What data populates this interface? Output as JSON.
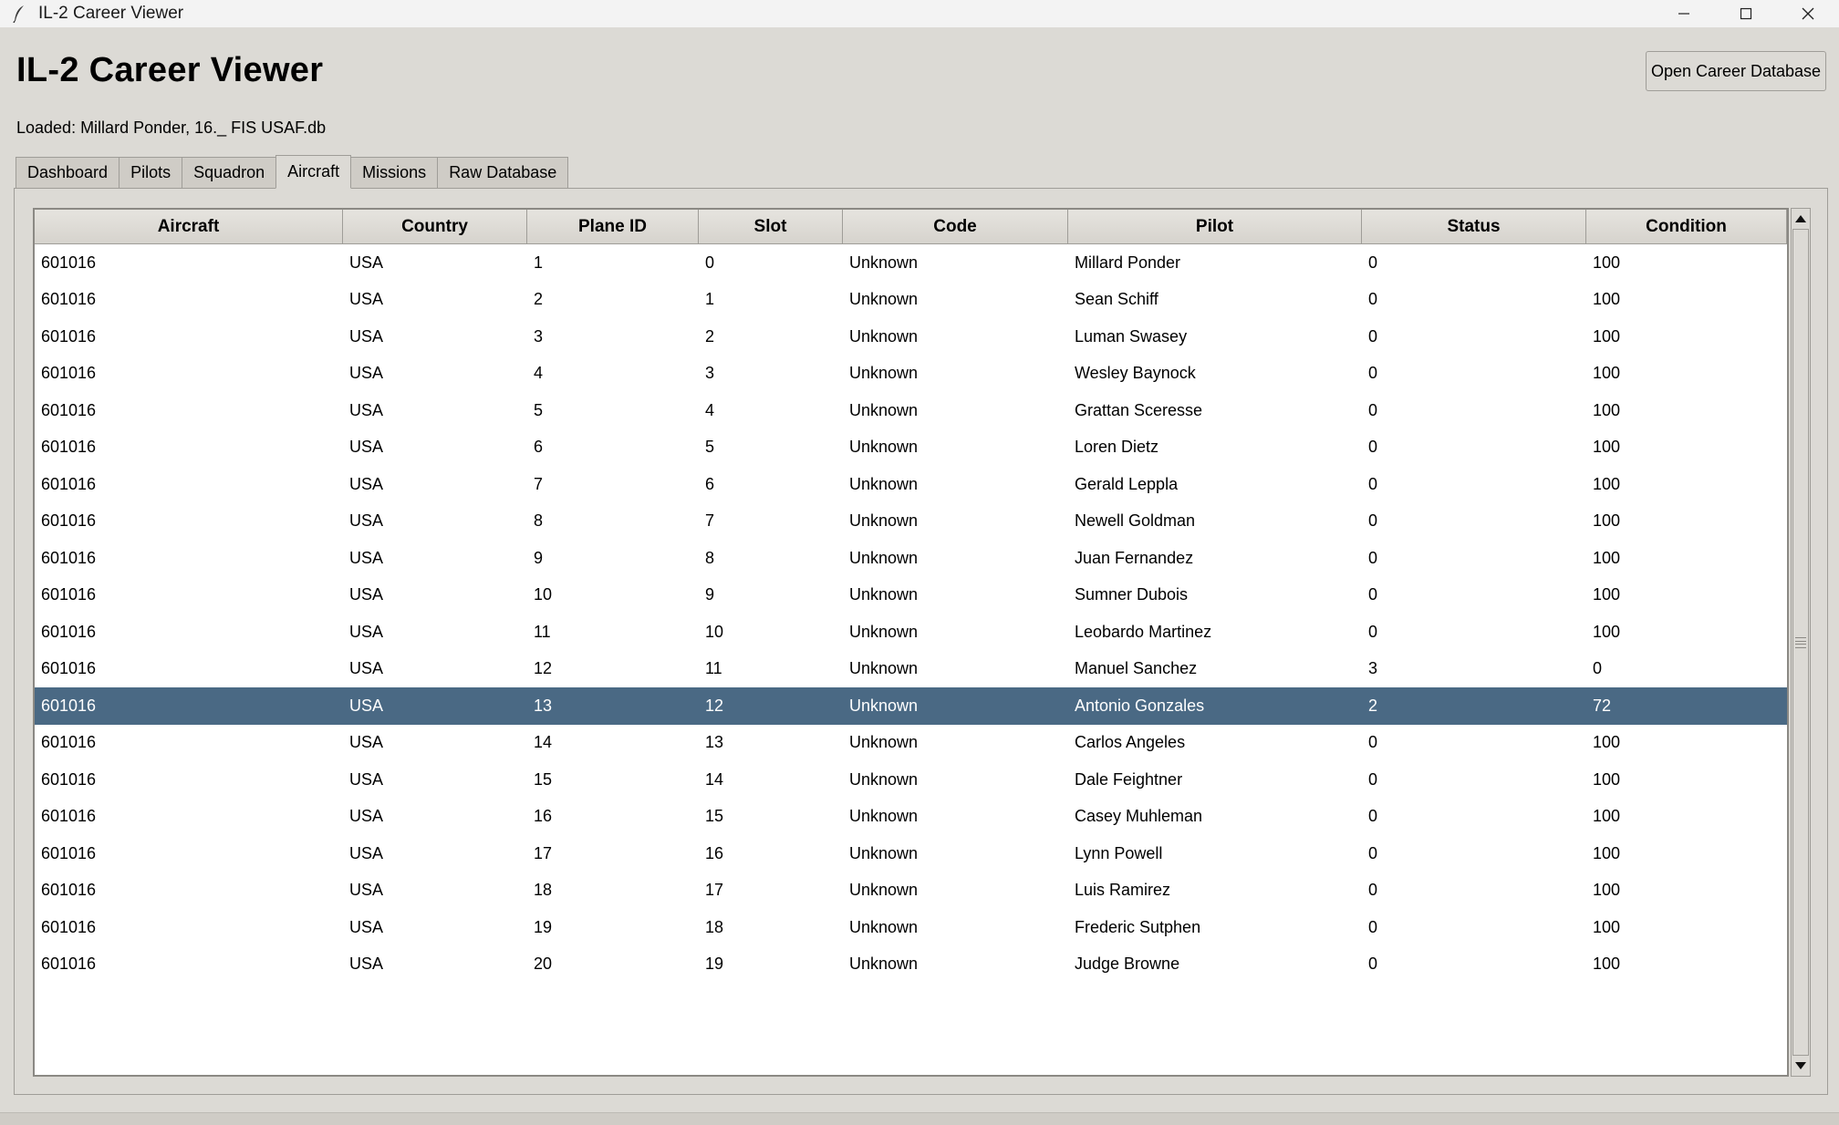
{
  "window": {
    "title": "IL-2 Career Viewer",
    "app_icon": "feather-icon",
    "controls": [
      "minimize-icon",
      "maximize-icon",
      "close-icon"
    ]
  },
  "header": {
    "title": "IL-2 Career Viewer",
    "loaded_text": "Loaded: Millard Ponder, 16._ FIS USAF.db",
    "open_button": "Open Career Database"
  },
  "tabs": [
    {
      "label": "Dashboard",
      "active": false
    },
    {
      "label": "Pilots",
      "active": false
    },
    {
      "label": "Squadron",
      "active": false
    },
    {
      "label": "Aircraft",
      "active": true
    },
    {
      "label": "Missions",
      "active": false
    },
    {
      "label": "Raw Database",
      "active": false
    }
  ],
  "table": {
    "columns": [
      "Aircraft",
      "Country",
      "Plane ID",
      "Slot",
      "Code",
      "Pilot",
      "Status",
      "Condition"
    ],
    "selected_index": 12,
    "rows": [
      [
        "601016",
        "USA",
        "1",
        "0",
        "Unknown",
        "Millard Ponder",
        "0",
        "100"
      ],
      [
        "601016",
        "USA",
        "2",
        "1",
        "Unknown",
        "Sean Schiff",
        "0",
        "100"
      ],
      [
        "601016",
        "USA",
        "3",
        "2",
        "Unknown",
        "Luman Swasey",
        "0",
        "100"
      ],
      [
        "601016",
        "USA",
        "4",
        "3",
        "Unknown",
        "Wesley Baynock",
        "0",
        "100"
      ],
      [
        "601016",
        "USA",
        "5",
        "4",
        "Unknown",
        "Grattan Sceresse",
        "0",
        "100"
      ],
      [
        "601016",
        "USA",
        "6",
        "5",
        "Unknown",
        "Loren Dietz",
        "0",
        "100"
      ],
      [
        "601016",
        "USA",
        "7",
        "6",
        "Unknown",
        "Gerald Leppla",
        "0",
        "100"
      ],
      [
        "601016",
        "USA",
        "8",
        "7",
        "Unknown",
        "Newell Goldman",
        "0",
        "100"
      ],
      [
        "601016",
        "USA",
        "9",
        "8",
        "Unknown",
        "Juan Fernandez",
        "0",
        "100"
      ],
      [
        "601016",
        "USA",
        "10",
        "9",
        "Unknown",
        "Sumner Dubois",
        "0",
        "100"
      ],
      [
        "601016",
        "USA",
        "11",
        "10",
        "Unknown",
        "Leobardo Martinez",
        "0",
        "100"
      ],
      [
        "601016",
        "USA",
        "12",
        "11",
        "Unknown",
        "Manuel Sanchez",
        "3",
        "0"
      ],
      [
        "601016",
        "USA",
        "13",
        "12",
        "Unknown",
        "Antonio Gonzales",
        "2",
        "72"
      ],
      [
        "601016",
        "USA",
        "14",
        "13",
        "Unknown",
        "Carlos Angeles",
        "0",
        "100"
      ],
      [
        "601016",
        "USA",
        "15",
        "14",
        "Unknown",
        "Dale Feightner",
        "0",
        "100"
      ],
      [
        "601016",
        "USA",
        "16",
        "15",
        "Unknown",
        "Casey Muhleman",
        "0",
        "100"
      ],
      [
        "601016",
        "USA",
        "17",
        "16",
        "Unknown",
        "Lynn Powell",
        "0",
        "100"
      ],
      [
        "601016",
        "USA",
        "18",
        "17",
        "Unknown",
        "Luis Ramirez",
        "0",
        "100"
      ],
      [
        "601016",
        "USA",
        "19",
        "18",
        "Unknown",
        "Frederic Sutphen",
        "0",
        "100"
      ],
      [
        "601016",
        "USA",
        "20",
        "19",
        "Unknown",
        "Judge Browne",
        "0",
        "100"
      ]
    ]
  },
  "colors": {
    "selection": "#4a6984",
    "background": "#dcdad5"
  }
}
